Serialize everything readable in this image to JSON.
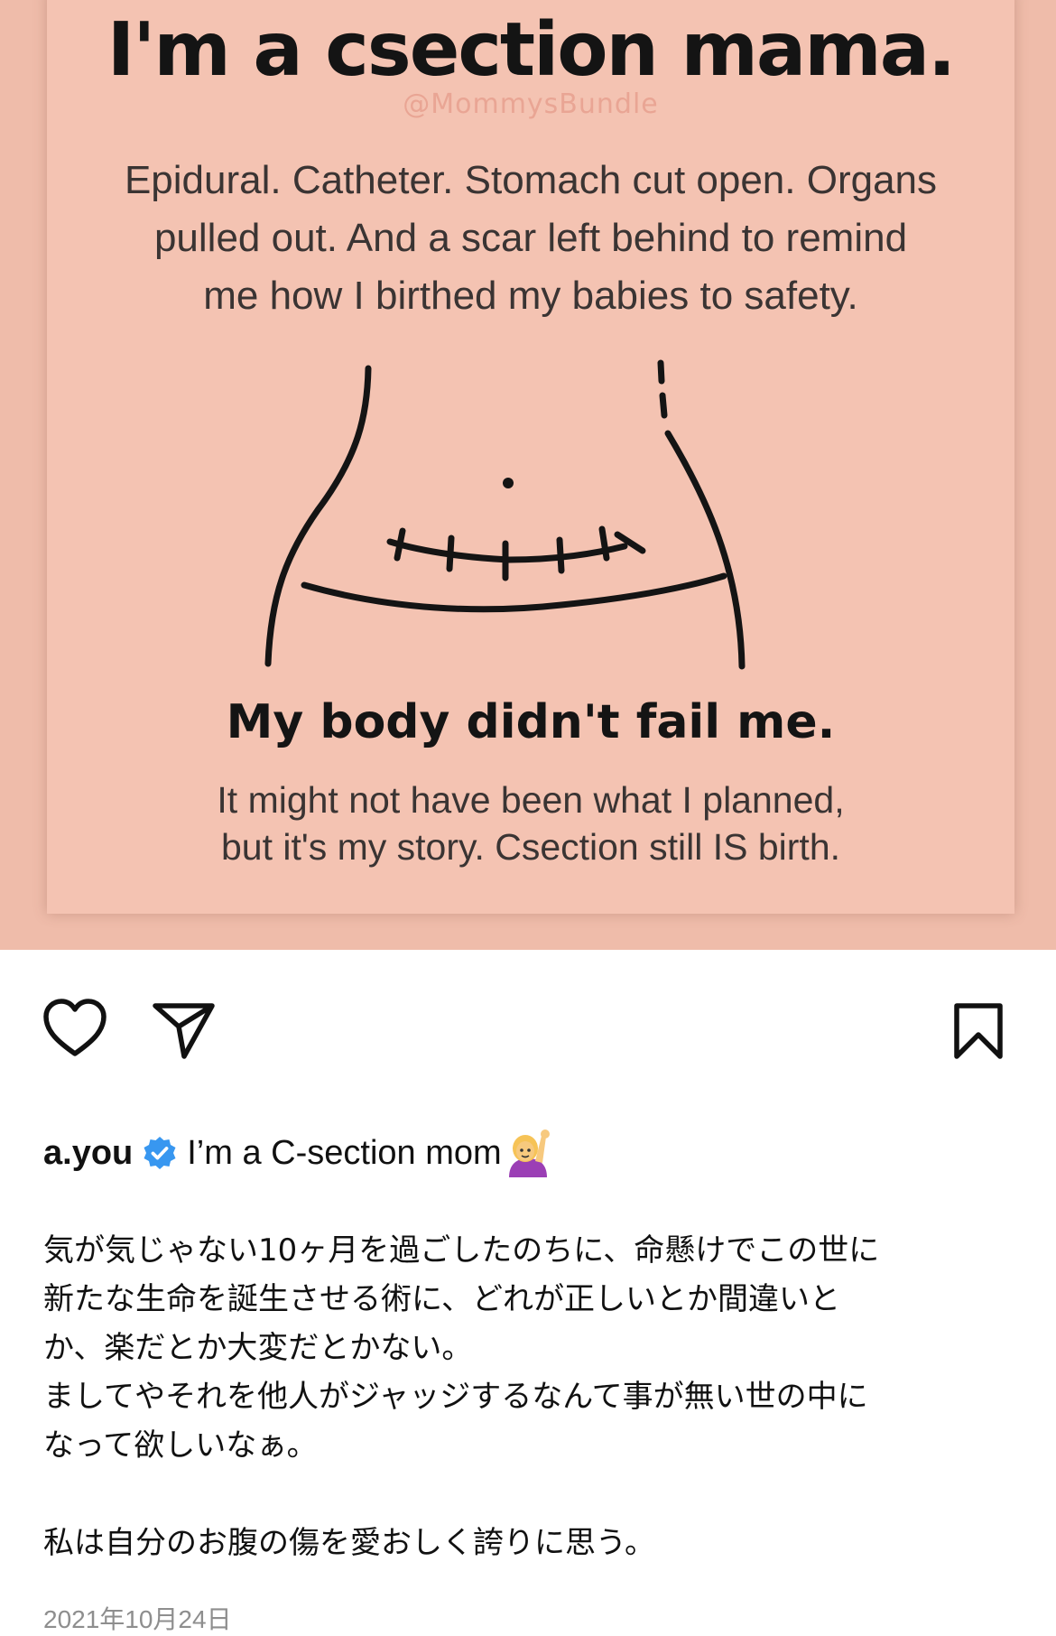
{
  "post_image": {
    "title": "I'm a csection mama.",
    "handle": "@MommysBundle",
    "body_lines": [
      "Epidural. Catheter. Stomach cut open. Organs",
      "pulled out. And a scar left behind to remind",
      "me how I birthed my babies to safety."
    ],
    "slogan": "My body didn't fail me.",
    "note_lines": [
      "It might not have been what I planned,",
      "but it's my story. Csection still IS birth."
    ]
  },
  "actions": {
    "like_icon": "heart-icon",
    "share_icon": "paper-plane-icon",
    "save_icon": "bookmark-icon"
  },
  "caption": {
    "username": "a.you",
    "verified_icon": "verified-badge-icon",
    "headline": "I’m a C-section mom",
    "emoji": "person-raising-hand-emoji",
    "lines": [
      "気が気じゃない10ヶ月を過ごしたのちに、命懸けでこの世に",
      "新たな生命を誕生させる術に、どれが正しいとか間違いと",
      "か、楽だとか大変だとかない。",
      "ましてやそれを他人がジャッジするなんて事が無い世の中に",
      "なって欲しいなぁ。",
      "",
      "私は自分のお腹の傷を愛おしく誇りに思う。"
    ],
    "date": "2021年10月24日"
  },
  "colors": {
    "image_bg": "#efbcaa",
    "card_bg": "#f4c3b2",
    "verified_blue": "#3897f0",
    "date_gray": "#8e8e8e"
  }
}
